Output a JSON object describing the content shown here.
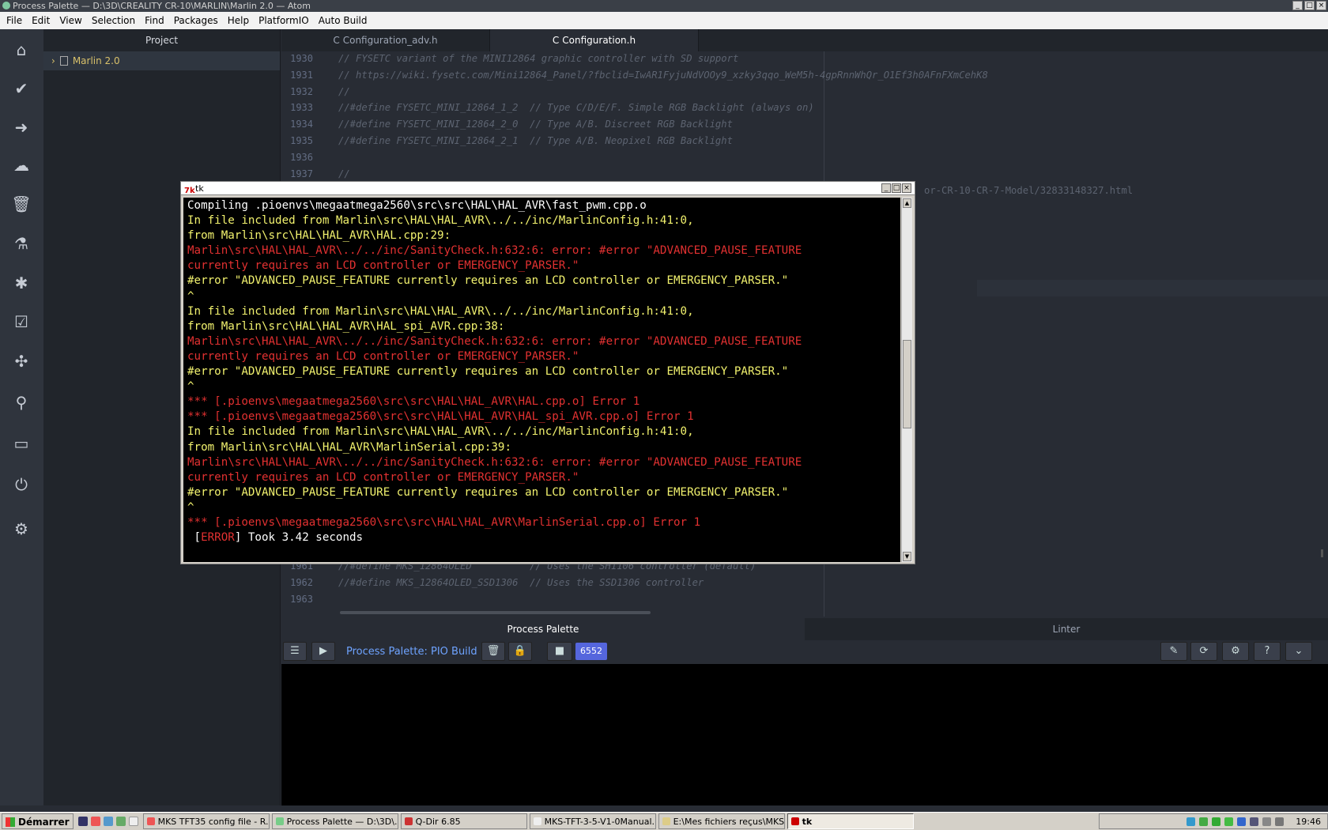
{
  "window_title": "Process Palette — D:\\3D\\CREALITY CR-10\\MARLIN\\Marlin 2.0 — Atom",
  "menu": [
    "File",
    "Edit",
    "View",
    "Selection",
    "Find",
    "Packages",
    "Help",
    "PlatformIO",
    "Auto Build"
  ],
  "left_bar_icons": [
    "home-icon",
    "check-icon",
    "arrow-right-icon",
    "cloud-upload-icon",
    "trash-icon",
    "flask-icon",
    "bug-icon",
    "checklist-icon",
    "network-icon",
    "search-icon",
    "terminal-icon",
    "plug-icon",
    "gear-icon"
  ],
  "project": {
    "title": "Project",
    "root": "Marlin 2.0"
  },
  "tabs": [
    {
      "label": "Configuration_adv.h"
    },
    {
      "label": "Configuration.h"
    }
  ],
  "editor": {
    "top_lines": [
      {
        "num": "1930",
        "text": "// FYSETC variant of the MINI12864 graphic controller with SD support"
      },
      {
        "num": "1931",
        "text": "// https://wiki.fysetc.com/Mini12864_Panel/?fbclid=IwAR1FyjuNdVOOy9_xzky3qqo_WeM5h-4gpRnnWhQr_O1Ef3h0AFnFXmCehK8"
      },
      {
        "num": "1932",
        "text": "//"
      },
      {
        "num": "1933",
        "text": "//#define FYSETC_MINI_12864_1_2  // Type C/D/E/F. Simple RGB Backlight (always on)"
      },
      {
        "num": "1934",
        "text": "//#define FYSETC_MINI_12864_2_0  // Type A/B. Discreet RGB Backlight"
      },
      {
        "num": "1935",
        "text": "//#define FYSETC_MINI_12864_2_1  // Type A/B. Neopixel RGB Backlight"
      },
      {
        "num": "1936",
        "text": ""
      },
      {
        "num": "1937",
        "text": "//"
      }
    ],
    "side_fragment": "or-CR-10-CR-7-Model/32833148327.html",
    "bottom_lines": [
      {
        "num": "1961",
        "text": "//#define MKS_12864OLED          // Uses the SH1106 controller (default)"
      },
      {
        "num": "1962",
        "text": "//#define MKS_12864OLED_SSD1306  // Uses the SSD1306 controller"
      },
      {
        "num": "1963",
        "text": ""
      }
    ]
  },
  "bottom_panel": {
    "tabs": [
      "Process Palette",
      "Linter"
    ],
    "process_label": "Process Palette: PIO Build",
    "pid": "6552"
  },
  "tk_window": {
    "title": "tk",
    "lines": [
      {
        "c": "w",
        "t": "Compiling .pioenvs\\megaatmega2560\\src\\src\\HAL\\HAL_AVR\\fast_pwm.cpp.o"
      },
      {
        "c": "y",
        "t": "In file included from Marlin\\src\\HAL\\HAL_AVR\\../../inc/MarlinConfig.h:41:0,"
      },
      {
        "c": "y",
        "t": "from Marlin\\src\\HAL\\HAL_AVR\\HAL.cpp:29:"
      },
      {
        "c": "r",
        "t": "Marlin\\src\\HAL\\HAL_AVR\\../../inc/SanityCheck.h:632:6: error: #error \"ADVANCED_PAUSE_FEATURE"
      },
      {
        "c": "r",
        "t": "currently requires an LCD controller or EMERGENCY_PARSER.\""
      },
      {
        "c": "y",
        "t": "#error \"ADVANCED_PAUSE_FEATURE currently requires an LCD controller or EMERGENCY_PARSER.\""
      },
      {
        "c": "y",
        "t": "^"
      },
      {
        "c": "y",
        "t": "In file included from Marlin\\src\\HAL\\HAL_AVR\\../../inc/MarlinConfig.h:41:0,"
      },
      {
        "c": "y",
        "t": "from Marlin\\src\\HAL\\HAL_AVR\\HAL_spi_AVR.cpp:38:"
      },
      {
        "c": "r",
        "t": "Marlin\\src\\HAL\\HAL_AVR\\../../inc/SanityCheck.h:632:6: error: #error \"ADVANCED_PAUSE_FEATURE"
      },
      {
        "c": "r",
        "t": "currently requires an LCD controller or EMERGENCY_PARSER.\""
      },
      {
        "c": "y",
        "t": "#error \"ADVANCED_PAUSE_FEATURE currently requires an LCD controller or EMERGENCY_PARSER.\""
      },
      {
        "c": "y",
        "t": "^"
      },
      {
        "c": "r",
        "t": "*** [.pioenvs\\megaatmega2560\\src\\src\\HAL\\HAL_AVR\\HAL.cpp.o] Error 1"
      },
      {
        "c": "r",
        "t": "*** [.pioenvs\\megaatmega2560\\src\\src\\HAL\\HAL_AVR\\HAL_spi_AVR.cpp.o] Error 1"
      },
      {
        "c": "y",
        "t": "In file included from Marlin\\src\\HAL\\HAL_AVR\\../../inc/MarlinConfig.h:41:0,"
      },
      {
        "c": "y",
        "t": "from Marlin\\src\\HAL\\HAL_AVR\\MarlinSerial.cpp:39:"
      },
      {
        "c": "r",
        "t": "Marlin\\src\\HAL\\HAL_AVR\\../../inc/SanityCheck.h:632:6: error: #error \"ADVANCED_PAUSE_FEATURE"
      },
      {
        "c": "r",
        "t": "currently requires an LCD controller or EMERGENCY_PARSER.\""
      },
      {
        "c": "y",
        "t": "#error \"ADVANCED_PAUSE_FEATURE currently requires an LCD controller or EMERGENCY_PARSER.\""
      },
      {
        "c": "y",
        "t": "^"
      },
      {
        "c": "r",
        "t": "*** [.pioenvs\\megaatmega2560\\src\\src\\HAL\\HAL_AVR\\MarlinSerial.cpp.o] Error 1"
      }
    ],
    "final_prefix": " [",
    "final_error": "ERROR",
    "final_suffix": "] Took 3.42 seconds"
  },
  "taskbar": {
    "start": "Démarrer",
    "tasks": [
      "MKS TFT35 config file - R...",
      "Process Palette — D:\\3D\\...",
      "Q-Dir 6.85",
      "MKS-TFT-3-5-V1-0Manual...",
      "E:\\Mes fichiers reçus\\MKS...",
      "tk"
    ],
    "clock": "19:46"
  }
}
